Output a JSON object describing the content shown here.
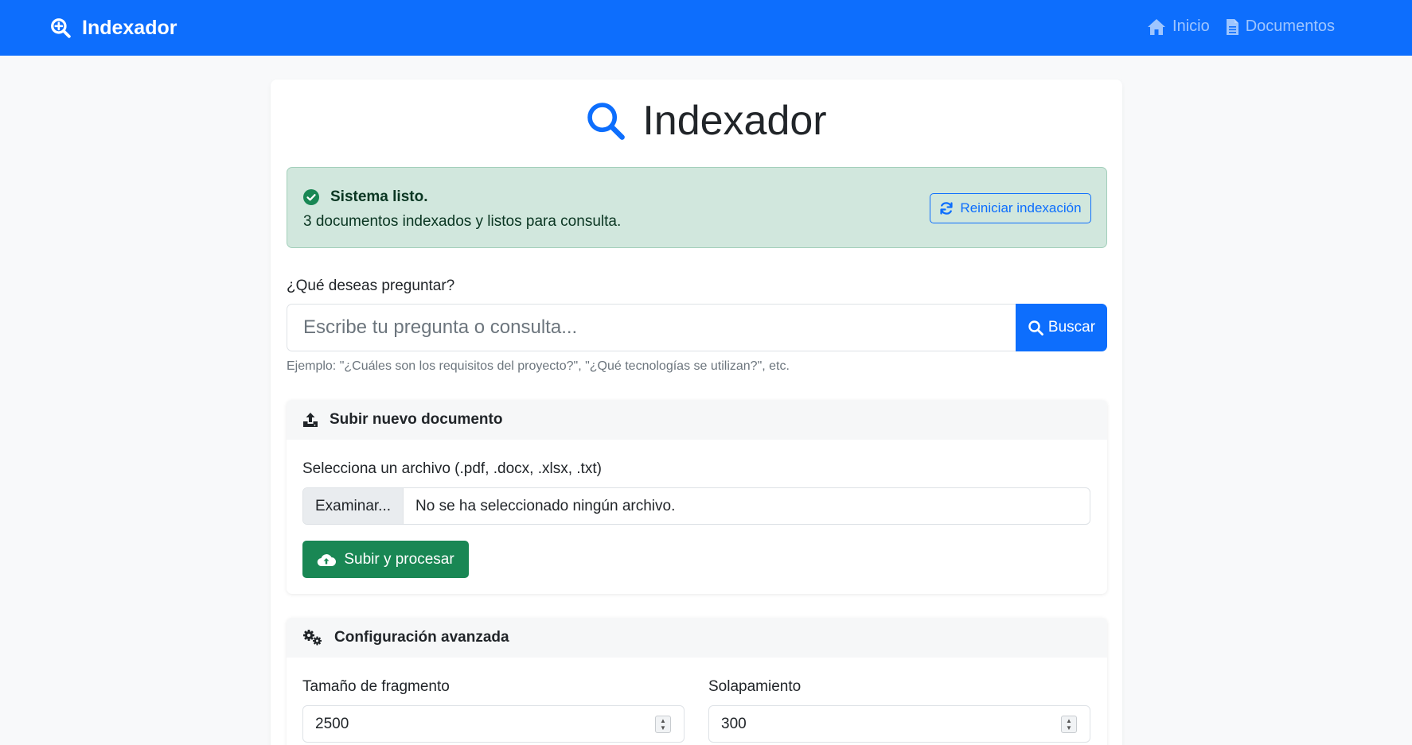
{
  "navbar": {
    "brand": "Indexador",
    "links": [
      {
        "label": "Inicio",
        "icon": "home-icon"
      },
      {
        "label": "Documentos",
        "icon": "file-icon"
      }
    ],
    "bg_color": "#0d6efd"
  },
  "page": {
    "title": "Indexador"
  },
  "status_alert": {
    "title": "Sistema listo.",
    "message": "3 documentos indexados y listos para consulta.",
    "reset_button": "Reiniciar indexación"
  },
  "query": {
    "label": "¿Qué deseas preguntar?",
    "placeholder": "Escribe tu pregunta o consulta...",
    "search_button": "Buscar",
    "help": "Ejemplo: \"¿Cuáles son los requisitos del proyecto?\", \"¿Qué tecnologías se utilizan?\", etc."
  },
  "upload": {
    "header": "Subir nuevo documento",
    "label": "Selecciona un archivo (.pdf, .docx, .xlsx, .txt)",
    "browse_button": "Examinar...",
    "file_status": "No se ha seleccionado ningún archivo.",
    "submit_button": "Subir y procesar"
  },
  "config": {
    "header": "Configuración avanzada",
    "chunk_size_label": "Tamaño de fragmento",
    "chunk_size_value": "2500",
    "overlap_label": "Solapamiento",
    "overlap_value": "300"
  },
  "colors": {
    "primary": "#0d6efd",
    "success": "#198754",
    "alert_bg": "#d1e7dd"
  }
}
